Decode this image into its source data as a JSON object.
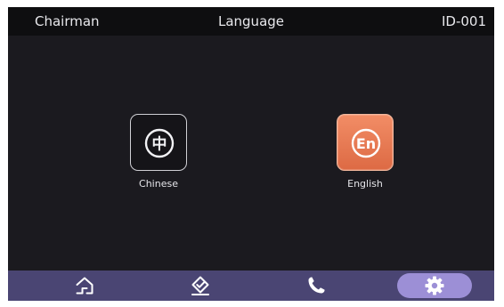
{
  "header": {
    "user": "Chairman",
    "title": "Language",
    "device_id": "ID-001"
  },
  "languages": [
    {
      "label": "Chinese",
      "icon_glyph": "中",
      "icon": "chinese-char-icon",
      "selected": false
    },
    {
      "label": "English",
      "icon_glyph": "En",
      "icon": "english-en-icon",
      "selected": true
    }
  ],
  "nav": [
    {
      "icon": "home-icon",
      "active": false
    },
    {
      "icon": "checkmark-icon",
      "active": false
    },
    {
      "icon": "phone-icon",
      "active": false
    },
    {
      "icon": "gear-icon",
      "active": true
    }
  ],
  "colors": {
    "background": "#1b1a1f",
    "header": "#0e0e10",
    "accent": "#e6744e",
    "navbar": "#4a4573",
    "nav_active": "#9c8fd6"
  }
}
